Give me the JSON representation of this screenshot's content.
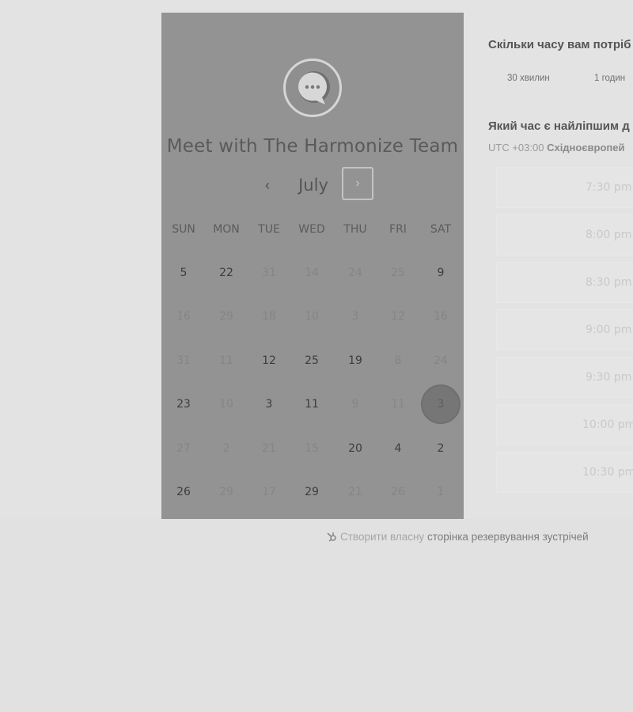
{
  "calendar": {
    "avatar_icon": "chat-bubble-icon",
    "title": "Meet with The Harmonize Team",
    "month": "July",
    "prev_icon": "‹",
    "next_icon": "›",
    "weekdays": [
      "SUN",
      "MON",
      "TUE",
      "WED",
      "THU",
      "FRI",
      "SAT"
    ],
    "weeks": [
      [
        {
          "d": "5",
          "on": true
        },
        {
          "d": "22",
          "on": true
        },
        {
          "d": "31",
          "on": false
        },
        {
          "d": "14",
          "on": false
        },
        {
          "d": "24",
          "on": false
        },
        {
          "d": "25",
          "on": false
        },
        {
          "d": "9",
          "on": true
        }
      ],
      [
        {
          "d": "16",
          "on": false
        },
        {
          "d": "29",
          "on": false
        },
        {
          "d": "18",
          "on": false
        },
        {
          "d": "10",
          "on": false
        },
        {
          "d": "3",
          "on": false
        },
        {
          "d": "12",
          "on": false
        },
        {
          "d": "16",
          "on": false
        }
      ],
      [
        {
          "d": "31",
          "on": false
        },
        {
          "d": "11",
          "on": false
        },
        {
          "d": "12",
          "on": true
        },
        {
          "d": "25",
          "on": true
        },
        {
          "d": "19",
          "on": true
        },
        {
          "d": "8",
          "on": false
        },
        {
          "d": "24",
          "on": false
        }
      ],
      [
        {
          "d": "23",
          "on": true
        },
        {
          "d": "10",
          "on": false
        },
        {
          "d": "3",
          "on": true
        },
        {
          "d": "11",
          "on": true
        },
        {
          "d": "9",
          "on": false
        },
        {
          "d": "11",
          "on": false
        },
        {
          "d": "3",
          "on": true,
          "selected": true
        }
      ],
      [
        {
          "d": "27",
          "on": false
        },
        {
          "d": "2",
          "on": false
        },
        {
          "d": "21",
          "on": false
        },
        {
          "d": "15",
          "on": false
        },
        {
          "d": "20",
          "on": true
        },
        {
          "d": "4",
          "on": true
        },
        {
          "d": "2",
          "on": true
        }
      ],
      [
        {
          "d": "26",
          "on": true
        },
        {
          "d": "29",
          "on": false
        },
        {
          "d": "17",
          "on": false
        },
        {
          "d": "29",
          "on": true
        },
        {
          "d": "21",
          "on": false
        },
        {
          "d": "26",
          "on": false
        },
        {
          "d": "1",
          "on": false
        }
      ]
    ]
  },
  "duration": {
    "question": "Скільки часу вам потріб",
    "options": [
      "30 хвилин",
      "1 годин"
    ]
  },
  "time": {
    "question": "Який час є найліпшим д",
    "tz_offset": "UTC +03:00",
    "tz_name": "Східноєвропей",
    "slots": [
      "7:30 pm",
      "8:00 pm",
      "8:30 pm",
      "9:00 pm",
      "9:30 pm",
      "10:00 pm",
      "10:30 pm"
    ]
  },
  "footer": {
    "icon": "hubspot-sprocket-icon",
    "prefix": "Створити власну",
    "link": "сторінка резервування зустрічей"
  }
}
